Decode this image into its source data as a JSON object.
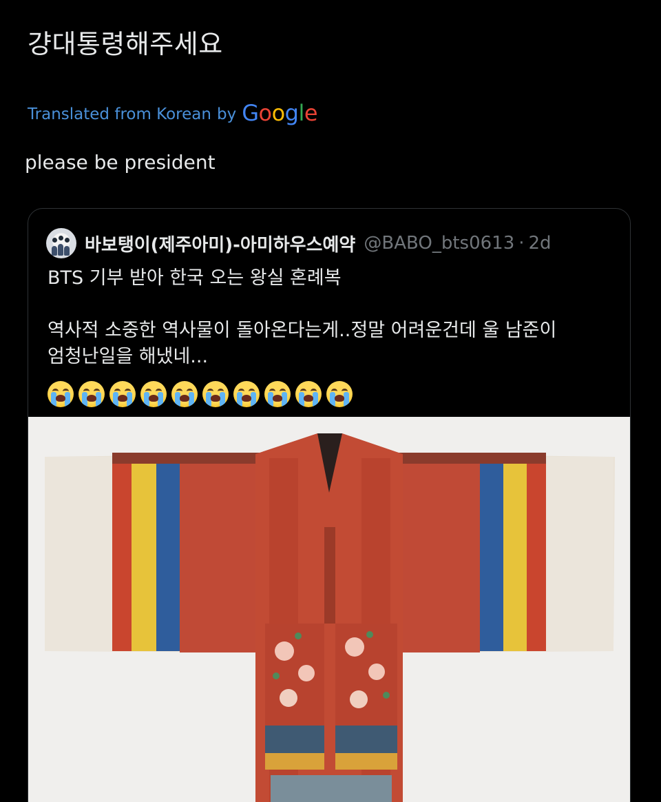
{
  "tweet": {
    "text": "걍대통령해주세요",
    "translated_from": "Translated from Korean",
    "by": "by",
    "google_letters": [
      {
        "char": "G",
        "color": "#4285f4"
      },
      {
        "char": "o",
        "color": "#ea4335"
      },
      {
        "char": "o",
        "color": "#fbbc05"
      },
      {
        "char": "g",
        "color": "#4285f4"
      },
      {
        "char": "l",
        "color": "#34a853"
      },
      {
        "char": "e",
        "color": "#ea4335"
      }
    ],
    "translation": "please be president"
  },
  "quote": {
    "name": "바보탱이(제주아미)-아미하우스예약",
    "handle": "@BABO_bts0613",
    "dot": "·",
    "time": "2d",
    "lines": [
      "BTS 기부 받아 한국 오는 왕실 혼례복",
      "",
      "역사적 소중한 역사물이 돌아온다는게..정말 어려운건데 울 남준이",
      "엄청난일을 해냈네..."
    ],
    "emoji_icon": "loudly-crying-face-icon",
    "emoji_count": 10,
    "media_description_icon": "hanbok-wedding-robe-image"
  },
  "colors": {
    "background": "#000000",
    "text": "#e7e9ea",
    "muted": "#71767b",
    "link_blue": "#4a90d9",
    "card_border": "#2f3336"
  }
}
